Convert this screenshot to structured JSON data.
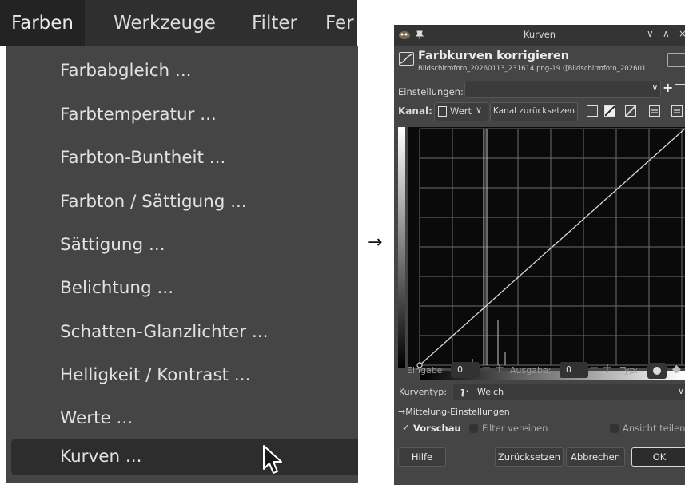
{
  "menubar": {
    "items": [
      "Farben",
      "Werkzeuge",
      "Filter",
      "Fer"
    ],
    "active_index": 0
  },
  "menu": {
    "items": [
      "Farbabgleich ...",
      "Farbtemperatur ...",
      "Farbton-Buntheit ...",
      "Farbton / Sättigung ...",
      "Sättigung ...",
      "Belichtung ...",
      "Schatten-Glanzlichter ...",
      "Helligkeit / Kontrast ...",
      "Werte ...",
      "Kurven ..."
    ],
    "hovered_index": 9
  },
  "transition_arrow": "→",
  "dialog": {
    "window_title": "Kurven",
    "titlebar_buttons": [
      "∨",
      "∧",
      "×"
    ],
    "header": {
      "title": "Farbkurven korrigieren",
      "subtitle": "Bildschirmfoto_20260113_231614.png-19 ([Bildschirmfoto_202601..."
    },
    "settings": {
      "label": "Einstellungen:",
      "value": "",
      "add_symbol": "+"
    },
    "channel": {
      "label": "Kanal:",
      "value": "Wert",
      "reset_label": "Kanal zurücksetzen"
    },
    "inputs": {
      "input_label": "Eingabe:",
      "input_value": "0",
      "output_label": "Ausgabe:",
      "output_value": "0",
      "type_label": "Typ:",
      "plus_minus": "−+"
    },
    "curve_type": {
      "label": "Kurventyp:",
      "value": "Weich"
    },
    "blending_label": "→Mittelung-Einstellungen",
    "preview": {
      "label": "Vorschau",
      "checked": true
    },
    "merge_filter": {
      "label": "Filter vereinen",
      "checked": false
    },
    "split_view": {
      "label": "Ansicht teilen",
      "checked": false
    },
    "buttons": {
      "help": "Hilfe",
      "reset": "Zurücksetzen",
      "cancel": "Abbrechen",
      "ok": "OK"
    },
    "colors": {
      "dialog_bg": "#454545",
      "graph_bg": "#0a0a0a",
      "grid": "#6e6e6e",
      "curve": "#d8d8d8"
    }
  }
}
